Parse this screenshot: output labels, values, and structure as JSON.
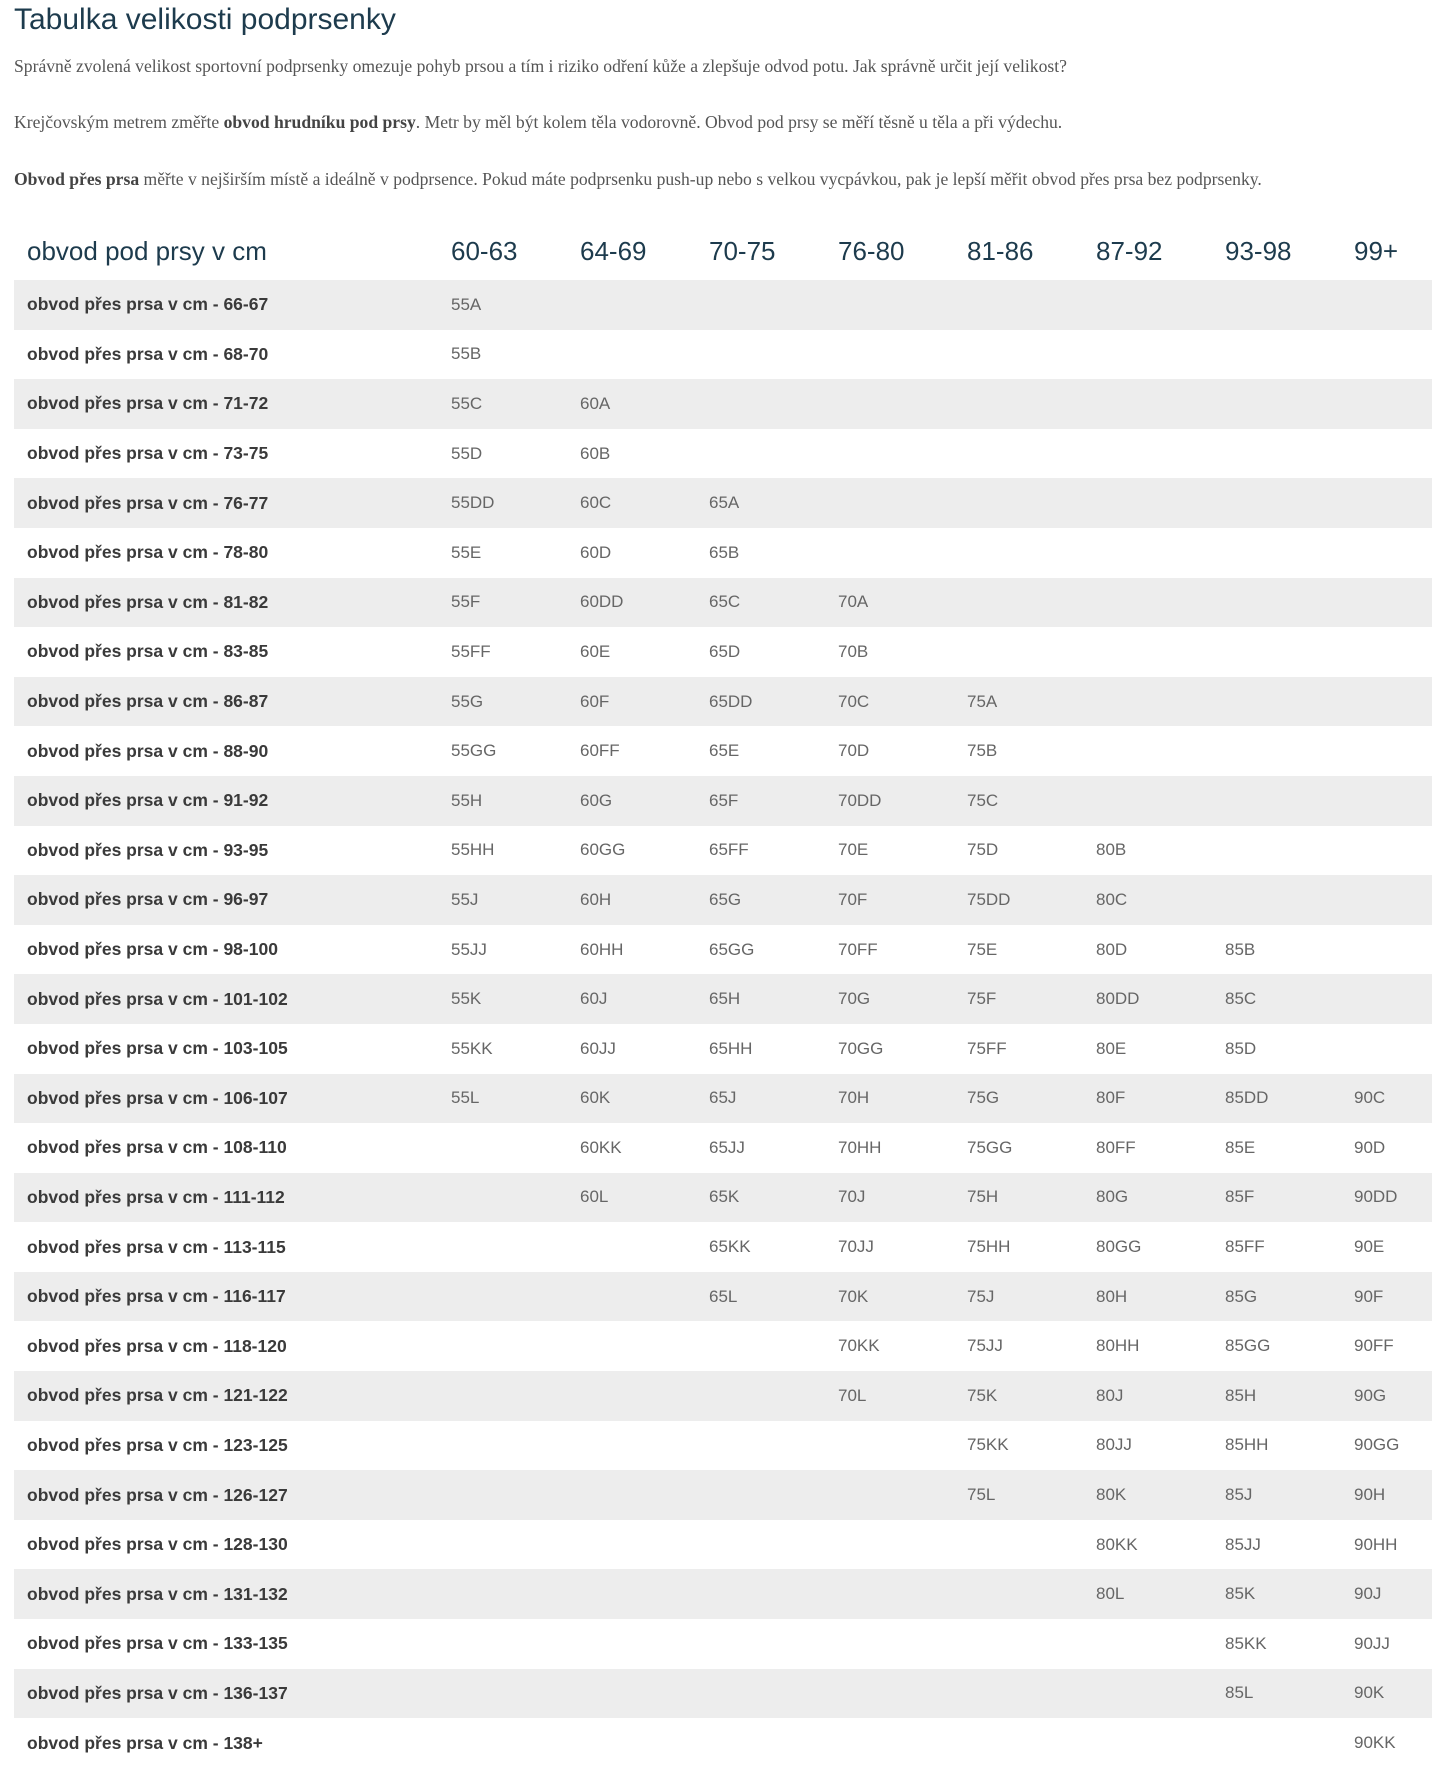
{
  "title": "Tabulka velikosti podprsenky",
  "intro": {
    "p1": "Správně zvolená velikost sportovní podprsenky omezuje pohyb prsou a tím i riziko odření kůže a zlepšuje odvod potu. Jak správně určit její velikost?",
    "p2_a": "Krejčovským metrem změřte ",
    "p2_b": "obvod hrudníku pod prsy",
    "p2_c": ". Metr by měl být kolem těla vodorovně. Obvod pod prsy se měří těsně u těla a při výdechu.",
    "p3_a": "Obvod přes prsa",
    "p3_b": " měřte v nejširším místě a ideálně v podprsence. Pokud máte podprsenku push-up nebo s velkou vycpávkou, pak je lepší měřit obvod přes prsa bez podprsenky."
  },
  "table": {
    "header": [
      "obvod pod prsy v cm",
      "60-63",
      "64-69",
      "70-75",
      "76-80",
      "81-86",
      "87-92",
      "93-98",
      "99+"
    ],
    "rows": [
      {
        "label": "obvod přes prsa v cm - 66-67",
        "cells": [
          "55A",
          "",
          "",
          "",
          "",
          "",
          "",
          ""
        ]
      },
      {
        "label": "obvod přes prsa v cm - 68-70",
        "cells": [
          "55B",
          "",
          "",
          "",
          "",
          "",
          "",
          ""
        ]
      },
      {
        "label": "obvod přes prsa v cm - 71-72",
        "cells": [
          "55C",
          "60A",
          "",
          "",
          "",
          "",
          "",
          ""
        ]
      },
      {
        "label": "obvod přes prsa v cm - 73-75",
        "cells": [
          "55D",
          "60B",
          "",
          "",
          "",
          "",
          "",
          ""
        ]
      },
      {
        "label": "obvod přes prsa v cm - 76-77",
        "cells": [
          "55DD",
          "60C",
          "65A",
          "",
          "",
          "",
          "",
          ""
        ]
      },
      {
        "label": "obvod přes prsa v cm - 78-80",
        "cells": [
          "55E",
          "60D",
          "65B",
          "",
          "",
          "",
          "",
          ""
        ]
      },
      {
        "label": "obvod přes prsa v cm - 81-82",
        "cells": [
          "55F",
          "60DD",
          "65C",
          "70A",
          "",
          "",
          "",
          ""
        ]
      },
      {
        "label": "obvod přes prsa v cm - 83-85",
        "cells": [
          "55FF",
          "60E",
          "65D",
          "70B",
          "",
          "",
          "",
          ""
        ]
      },
      {
        "label": "obvod přes prsa v cm - 86-87",
        "cells": [
          "55G",
          "60F",
          "65DD",
          "70C",
          "75A",
          "",
          "",
          ""
        ]
      },
      {
        "label": "obvod přes prsa v cm - 88-90",
        "cells": [
          "55GG",
          "60FF",
          "65E",
          "70D",
          "75B",
          "",
          "",
          ""
        ]
      },
      {
        "label": "obvod přes prsa v cm - 91-92",
        "cells": [
          "55H",
          "60G",
          "65F",
          "70DD",
          "75C",
          "",
          "",
          ""
        ]
      },
      {
        "label": "obvod přes prsa v cm - 93-95",
        "cells": [
          "55HH",
          "60GG",
          "65FF",
          "70E",
          "75D",
          "80B",
          "",
          ""
        ]
      },
      {
        "label": "obvod přes prsa v cm - 96-97",
        "cells": [
          "55J",
          "60H",
          "65G",
          "70F",
          "75DD",
          "80C",
          "",
          ""
        ]
      },
      {
        "label": "obvod přes prsa v cm - 98-100",
        "cells": [
          "55JJ",
          "60HH",
          "65GG",
          "70FF",
          "75E",
          "80D",
          "85B",
          ""
        ]
      },
      {
        "label": "obvod přes prsa v cm - 101-102",
        "cells": [
          "55K",
          "60J",
          "65H",
          "70G",
          "75F",
          "80DD",
          "85C",
          ""
        ]
      },
      {
        "label": "obvod přes prsa v cm - 103-105",
        "cells": [
          "55KK",
          "60JJ",
          "65HH",
          "70GG",
          "75FF",
          "80E",
          "85D",
          ""
        ]
      },
      {
        "label": "obvod přes prsa v cm - 106-107",
        "cells": [
          "55L",
          "60K",
          "65J",
          "70H",
          "75G",
          "80F",
          "85DD",
          "90C"
        ]
      },
      {
        "label": "obvod přes prsa v cm - 108-110",
        "cells": [
          "",
          "60KK",
          "65JJ",
          "70HH",
          "75GG",
          "80FF",
          "85E",
          "90D"
        ]
      },
      {
        "label": "obvod přes prsa v cm - 111-112",
        "cells": [
          "",
          "60L",
          "65K",
          "70J",
          "75H",
          "80G",
          "85F",
          "90DD"
        ]
      },
      {
        "label": "obvod přes prsa v cm - 113-115",
        "cells": [
          "",
          "",
          "65KK",
          "70JJ",
          "75HH",
          "80GG",
          "85FF",
          "90E"
        ]
      },
      {
        "label": "obvod přes prsa v cm - 116-117",
        "cells": [
          "",
          "",
          "65L",
          "70K",
          "75J",
          "80H",
          "85G",
          "90F"
        ]
      },
      {
        "label": "obvod přes prsa v cm - 118-120",
        "cells": [
          "",
          "",
          "",
          "70KK",
          "75JJ",
          "80HH",
          "85GG",
          "90FF"
        ]
      },
      {
        "label": "obvod přes prsa v cm - 121-122",
        "cells": [
          "",
          "",
          "",
          "70L",
          "75K",
          "80J",
          "85H",
          "90G"
        ]
      },
      {
        "label": "obvod přes prsa v cm - 123-125",
        "cells": [
          "",
          "",
          "",
          "",
          "75KK",
          "80JJ",
          "85HH",
          "90GG"
        ]
      },
      {
        "label": "obvod přes prsa v cm - 126-127",
        "cells": [
          "",
          "",
          "",
          "",
          "75L",
          "80K",
          "85J",
          "90H"
        ]
      },
      {
        "label": "obvod přes prsa v cm - 128-130",
        "cells": [
          "",
          "",
          "",
          "",
          "",
          "80KK",
          "85JJ",
          "90HH"
        ]
      },
      {
        "label": "obvod přes prsa v cm - 131-132",
        "cells": [
          "",
          "",
          "",
          "",
          "",
          "80L",
          "85K",
          "90J"
        ]
      },
      {
        "label": "obvod přes prsa v cm - 133-135",
        "cells": [
          "",
          "",
          "",
          "",
          "",
          "",
          "85KK",
          "90JJ"
        ]
      },
      {
        "label": "obvod přes prsa v cm - 136-137",
        "cells": [
          "",
          "",
          "",
          "",
          "",
          "",
          "85L",
          "90K"
        ]
      },
      {
        "label": "obvod přes prsa v cm - 138+",
        "cells": [
          "",
          "",
          "",
          "",
          "",
          "",
          "",
          "90KK"
        ]
      }
    ]
  }
}
